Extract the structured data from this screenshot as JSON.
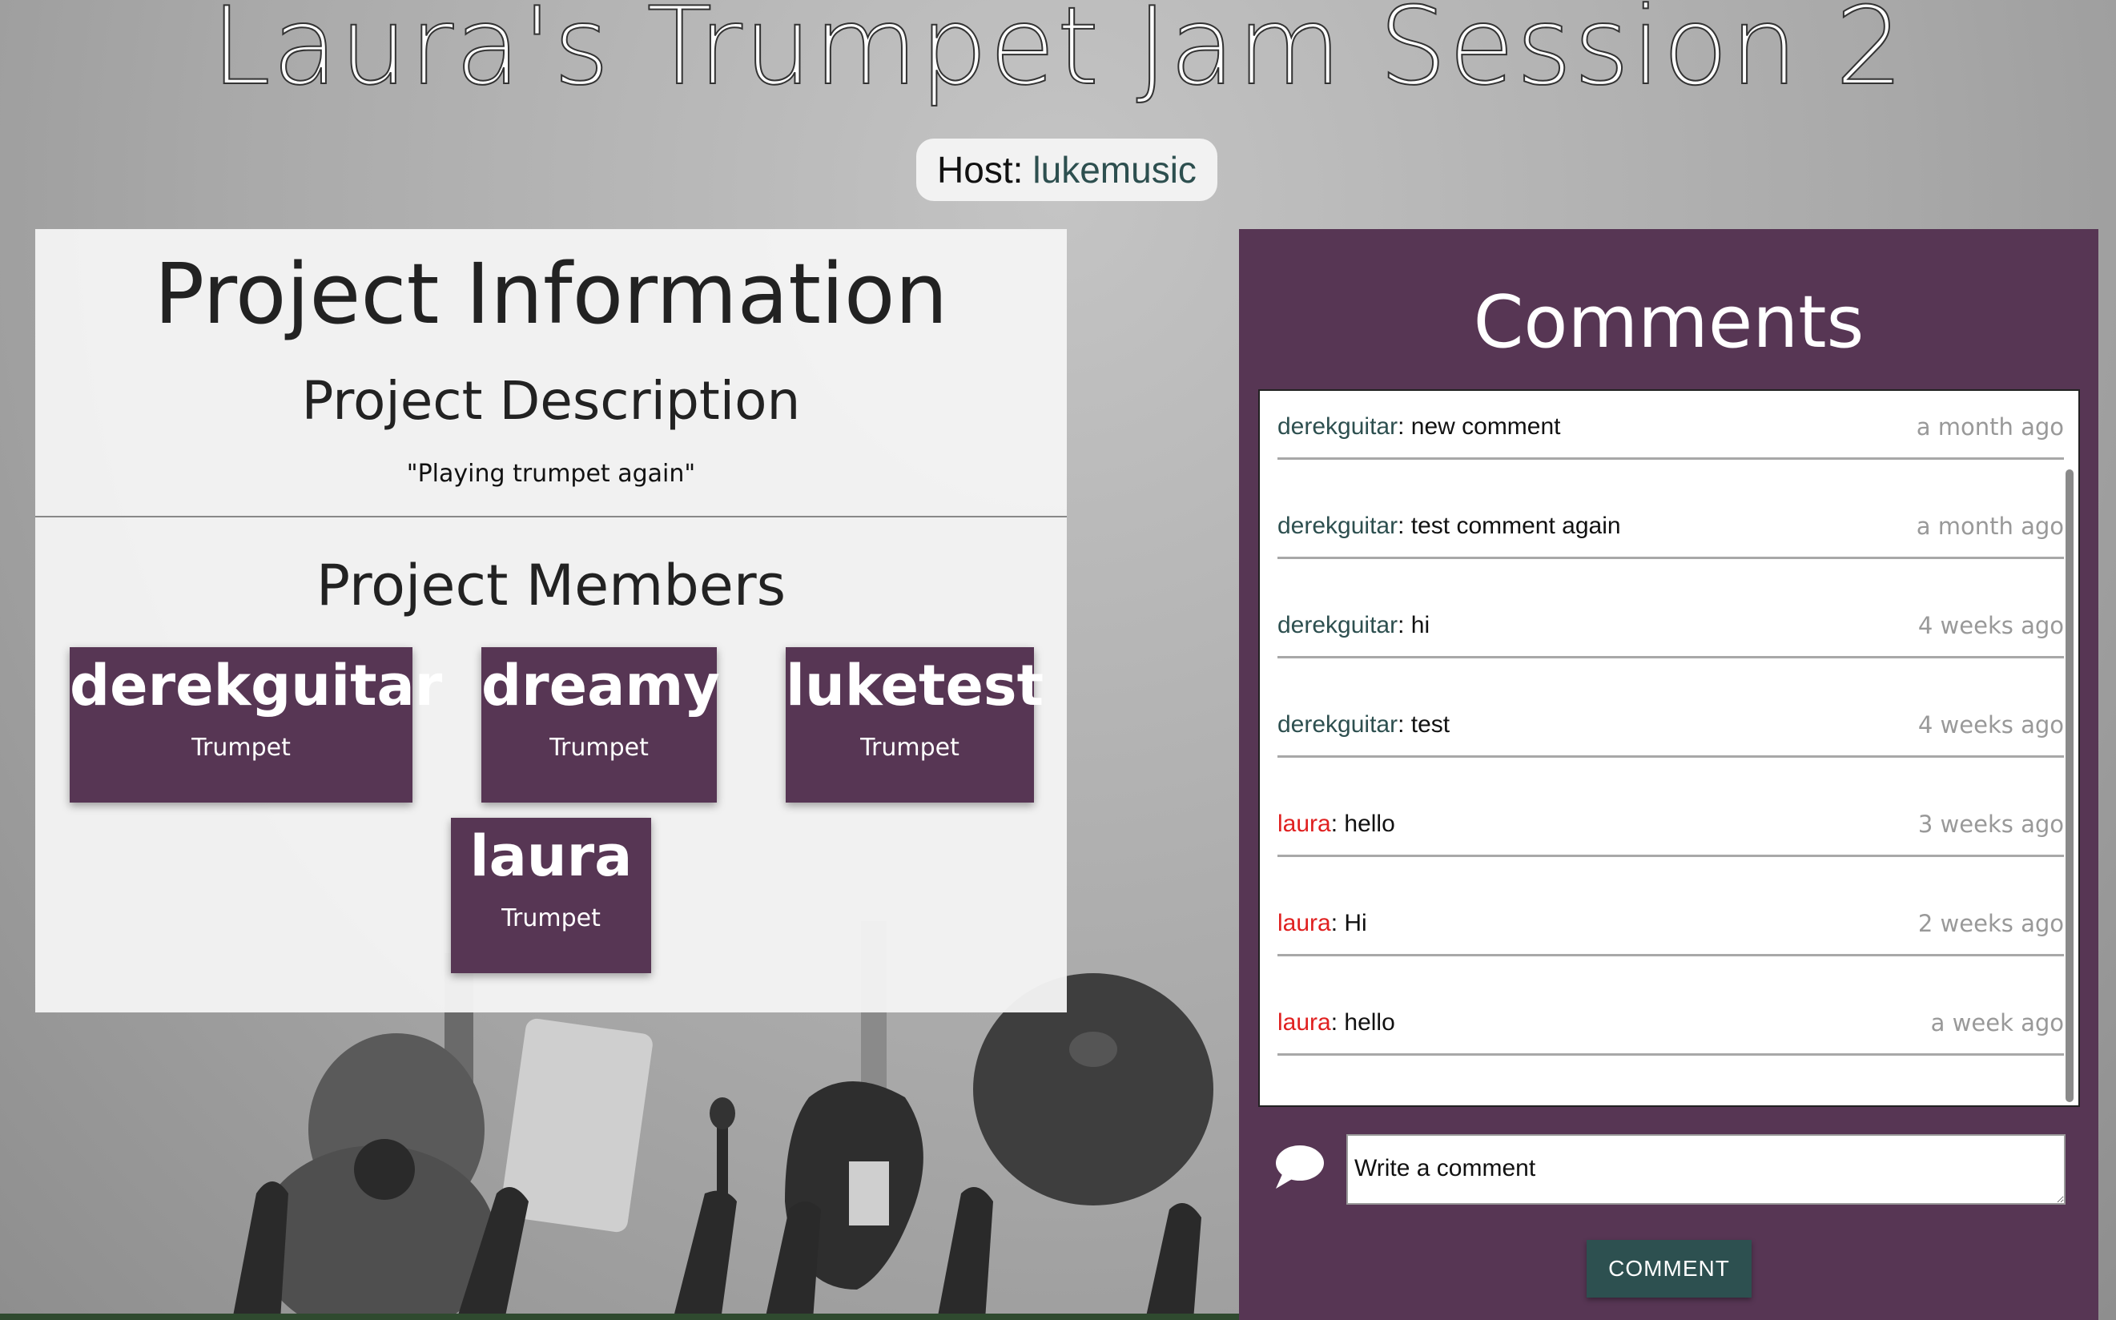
{
  "page": {
    "title": "Laura's Trumpet Jam Session 2"
  },
  "host": {
    "label": "Host:",
    "name": "lukemusic"
  },
  "project_info": {
    "title": "Project Information",
    "description_title": "Project Description",
    "description": "\"Playing trumpet again\"",
    "members_title": "Project Members",
    "members": [
      {
        "name": "derekguitar",
        "instrument": "Trumpet"
      },
      {
        "name": "dreamy",
        "instrument": "Trumpet"
      },
      {
        "name": "luketest",
        "instrument": "Trumpet"
      },
      {
        "name": "laura",
        "instrument": "Trumpet"
      }
    ]
  },
  "comments": {
    "title": "Comments",
    "items": [
      {
        "author": "derekguitar",
        "text": "new comment",
        "time": "a month ago"
      },
      {
        "author": "derekguitar",
        "text": "test comment again",
        "time": "a month ago"
      },
      {
        "author": "derekguitar",
        "text": "hi",
        "time": "4 weeks ago"
      },
      {
        "author": "derekguitar",
        "text": "test",
        "time": "4 weeks ago"
      },
      {
        "author": "laura",
        "text": "hello",
        "time": "3 weeks ago"
      },
      {
        "author": "laura",
        "text": "Hi",
        "time": "2 weeks ago"
      },
      {
        "author": "laura",
        "text": "hello",
        "time": "a week ago"
      }
    ],
    "input_placeholder": "Write a comment",
    "submit_label": "COMMENT",
    "icon": "speech-bubble-icon"
  },
  "colors": {
    "panel_purple": "#573654",
    "host_link": "#2d4f4f",
    "author_teal": "#2d4f4f",
    "author_red": "#e02020",
    "button_teal": "#2d5050"
  }
}
